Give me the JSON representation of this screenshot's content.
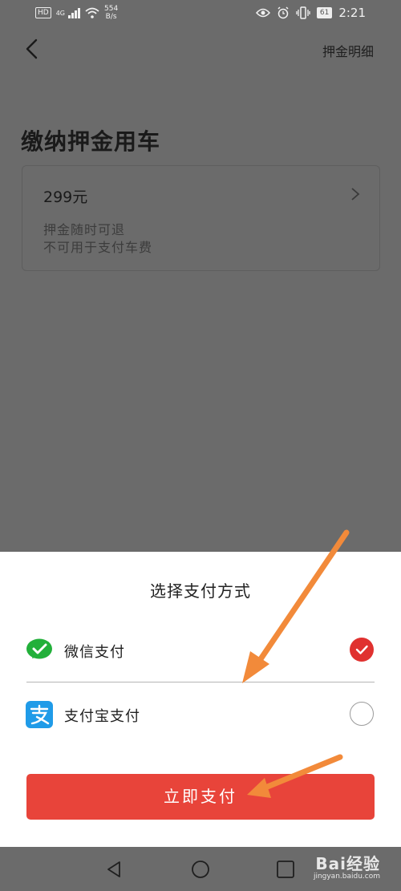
{
  "status_bar": {
    "hd": "HD",
    "network": "4G",
    "speed_value": "554",
    "speed_unit": "B/s",
    "battery": "61",
    "time": "2:21"
  },
  "header": {
    "deposit_detail_link": "押金明细",
    "back_icon": "chevron-left-icon"
  },
  "page": {
    "title": "缴纳押金用车",
    "deposit": {
      "amount": "299元",
      "note_line1": "押金随时可退",
      "note_line2": "不可用于支付车费"
    }
  },
  "payment_sheet": {
    "title": "选择支付方式",
    "options": [
      {
        "label": "微信支付",
        "icon": "wechat-pay-icon",
        "selected": true
      },
      {
        "label": "支付宝支付",
        "icon": "alipay-icon",
        "selected": false
      }
    ],
    "pay_button": "立即支付"
  },
  "watermark": {
    "logo": "Bai经验",
    "url": "jingyan.baidu.com"
  },
  "colors": {
    "accent_red": "#e8443a",
    "check_red": "#e0312f",
    "wechat_green": "#22b03a",
    "alipay_blue": "#1f9be8",
    "annotation_orange": "#f28a3a",
    "dim_overlay": "#6b6b6b"
  }
}
